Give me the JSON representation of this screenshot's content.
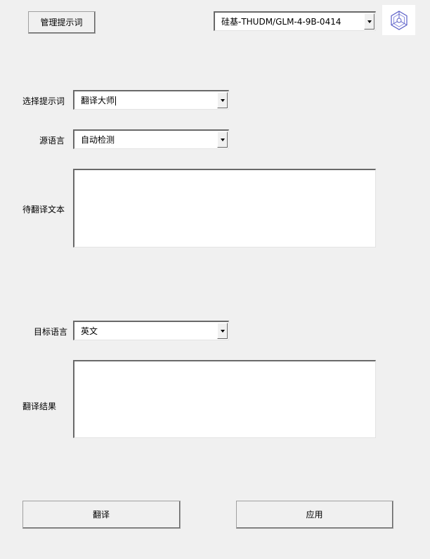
{
  "toolbar": {
    "manage_prompts_label": "管理提示词",
    "model_value": "硅基-THUDM/GLM-4-9B-0414",
    "logo_icon": "hexagon-logo-icon",
    "logo_color": "#5b5fc7"
  },
  "form": {
    "prompt": {
      "label": "选择提示词",
      "value": "翻译大师"
    },
    "source_lang": {
      "label": "源语言",
      "value": "自动检测"
    },
    "input_text": {
      "label": "待翻译文本",
      "value": ""
    },
    "target_lang": {
      "label": "目标语言",
      "value": "英文"
    },
    "result": {
      "label": "翻译结果",
      "value": ""
    }
  },
  "actions": {
    "translate_label": "翻译",
    "apply_label": "应用"
  }
}
